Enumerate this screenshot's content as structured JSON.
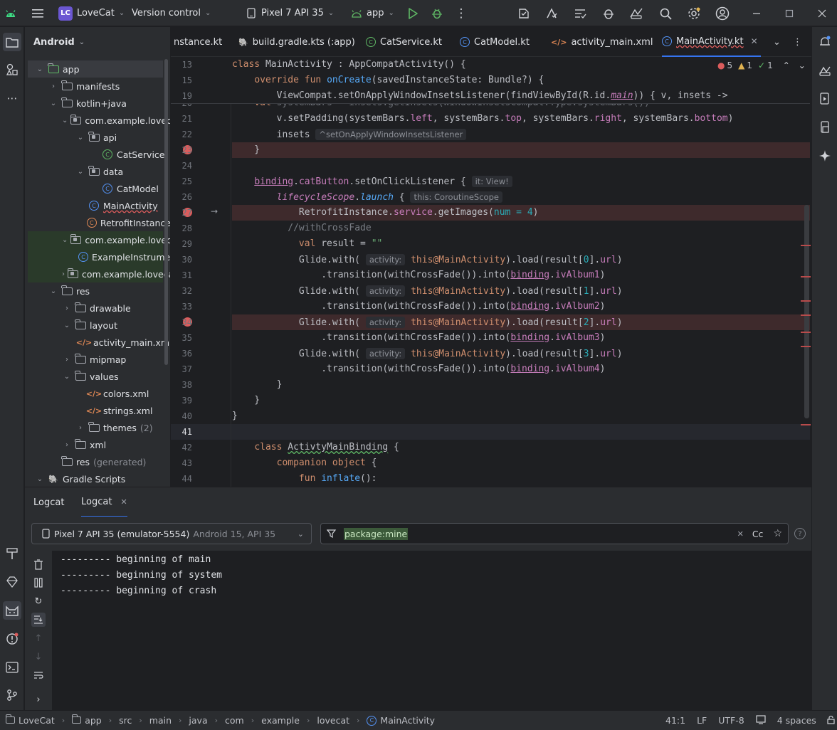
{
  "titlebar": {
    "project_badge": "LC",
    "project_name": "LoveCat",
    "vcs": "Version control",
    "device": "Pixel 7 API 35",
    "run_config": "app"
  },
  "project_panel": {
    "view": "Android",
    "tree": [
      {
        "label": "app",
        "depth": 0,
        "kind": "module",
        "expanded": true,
        "selected": true
      },
      {
        "label": "manifests",
        "depth": 1,
        "kind": "folder",
        "expanded": false
      },
      {
        "label": "kotlin+java",
        "depth": 1,
        "kind": "folder",
        "expanded": true
      },
      {
        "label": "com.example.lovecat",
        "depth": 2,
        "kind": "package",
        "expanded": true
      },
      {
        "label": "api",
        "depth": 3,
        "kind": "package",
        "expanded": true
      },
      {
        "label": "CatService",
        "depth": 4,
        "kind": "kt-green"
      },
      {
        "label": "data",
        "depth": 3,
        "kind": "package",
        "expanded": true
      },
      {
        "label": "CatModel",
        "depth": 4,
        "kind": "kt-blue"
      },
      {
        "label": "MainActivity",
        "depth": 3,
        "kind": "kt-blue"
      },
      {
        "label": "RetrofitInstance",
        "depth": 3,
        "kind": "kt-orange"
      },
      {
        "label": "com.example.lovecat",
        "depth": 2,
        "kind": "package",
        "expanded": true,
        "green": true
      },
      {
        "label": "ExampleInstrumentedTest",
        "depth": 3,
        "kind": "kt-blue",
        "green": true
      },
      {
        "label": "com.example.lovecat",
        "depth": 2,
        "kind": "package",
        "expanded": false,
        "green": true
      },
      {
        "label": "res",
        "depth": 1,
        "kind": "folder",
        "expanded": true
      },
      {
        "label": "drawable",
        "depth": 2,
        "kind": "folder",
        "expanded": false
      },
      {
        "label": "layout",
        "depth": 2,
        "kind": "folder",
        "expanded": true
      },
      {
        "label": "activity_main.xml",
        "depth": 3,
        "kind": "xml"
      },
      {
        "label": "mipmap",
        "depth": 2,
        "kind": "folder",
        "expanded": false
      },
      {
        "label": "values",
        "depth": 2,
        "kind": "folder",
        "expanded": true
      },
      {
        "label": "colors.xml",
        "depth": 3,
        "kind": "xml"
      },
      {
        "label": "strings.xml",
        "depth": 3,
        "kind": "xml"
      },
      {
        "label": "themes",
        "depth": 3,
        "kind": "folder",
        "expanded": false,
        "extra": "(2)"
      },
      {
        "label": "xml",
        "depth": 2,
        "kind": "folder",
        "expanded": false
      },
      {
        "label": "res",
        "depth": 1,
        "kind": "folder",
        "extra": "(generated)",
        "noarrow": true
      },
      {
        "label": "Gradle Scripts",
        "depth": 0,
        "kind": "gradle",
        "expanded": true
      }
    ]
  },
  "editor": {
    "tabs": [
      {
        "label": "nstance.kt",
        "icon": "kt"
      },
      {
        "label": "build.gradle.kts (:app)",
        "icon": "gradle"
      },
      {
        "label": "CatService.kt",
        "icon": "kt"
      },
      {
        "label": "CatModel.kt",
        "icon": "kt"
      },
      {
        "label": "activity_main.xml",
        "icon": "xml"
      },
      {
        "label": "MainActivity.kt",
        "icon": "kt",
        "active": true
      }
    ],
    "inspections": {
      "errors": "5",
      "warnings": "1",
      "ok": "1"
    },
    "sticky_lines": [
      "13",
      "15",
      "19"
    ],
    "line_numbers": [
      "20",
      "21",
      "22",
      "23",
      "24",
      "25",
      "26",
      "27",
      "28",
      "29",
      "30",
      "31",
      "32",
      "33",
      "34",
      "35",
      "36",
      "37",
      "38",
      "39",
      "40",
      "41",
      "42",
      "43",
      "44"
    ],
    "hints": {
      "insets": "^setOnApplyWindowInsetsListener",
      "it_view": "it: View!",
      "this_scope": "this: CoroutineScope",
      "activity": "activity:"
    }
  },
  "logcat": {
    "tab_title": "Logcat",
    "tab_name": "Logcat",
    "device": "Pixel 7 API 35 (emulator-5554)",
    "device_detail": "Android 15, API 35",
    "filter": "package:mine",
    "case_label": "Cc",
    "lines": [
      "--------- beginning of main",
      "--------- beginning of system",
      "--------- beginning of crash"
    ]
  },
  "statusbar": {
    "crumbs": [
      "LoveCat",
      "app",
      "src",
      "main",
      "java",
      "com",
      "example",
      "lovecat",
      "MainActivity"
    ],
    "position": "41:1",
    "line_sep": "LF",
    "encoding": "UTF-8",
    "indent": "4 spaces"
  }
}
